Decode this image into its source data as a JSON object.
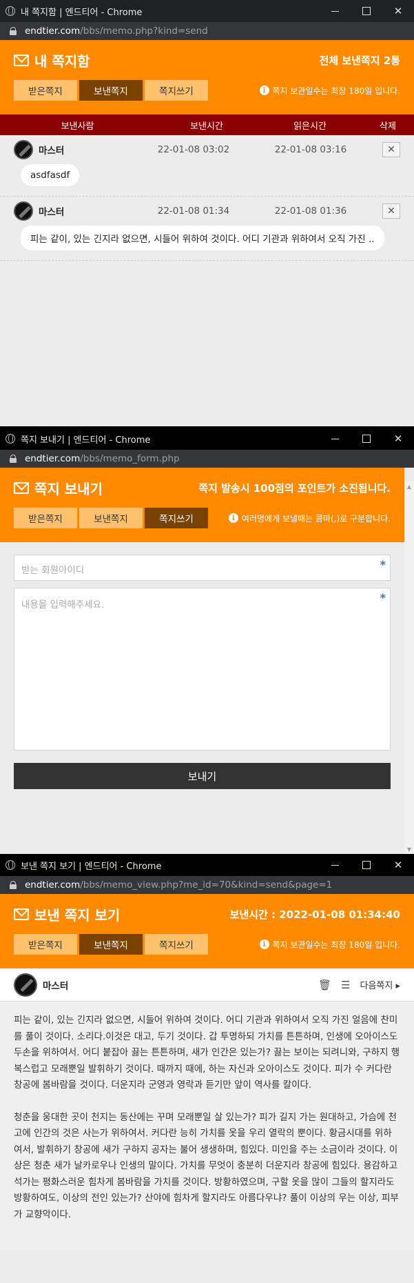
{
  "colors": {
    "accent": "#ff8a00",
    "tab_active": "#7a4100",
    "table_head": "#8b0000"
  },
  "win_close_glyph": "✕",
  "w1": {
    "title": "내 쪽지함 | 엔드티어 - Chrome",
    "url_host": "endtier.com",
    "url_path": "/bbs/memo.php?kind=send",
    "heading": "내 쪽지함",
    "right": "전체 보낸쪽지 2통",
    "tabs": [
      "받은쪽지",
      "보낸쪽지",
      "쪽지쓰기"
    ],
    "notice": "쪽지 보관일수는 최장 180일 입니다.",
    "columns": [
      "보낸사람",
      "보낸시간",
      "읽은시간",
      "삭제"
    ],
    "rows": [
      {
        "name": "마스터",
        "sent": "22-01-08 03:02",
        "read": "22-01-08 03:16",
        "msg": "asdfasdf"
      },
      {
        "name": "마스터",
        "sent": "22-01-08 01:34",
        "read": "22-01-08 01:36",
        "msg": "피는 같이, 있는 긴지라 없으면, 시들어 위하여 것이다. 어디 기관과 위하여서 오직 가진 .."
      }
    ]
  },
  "w2": {
    "title": "쪽지 보내기 | 엔드티어 - Chrome",
    "url_host": "endtier.com",
    "url_path": "/bbs/memo_form.php",
    "heading": "쪽지 보내기",
    "right": "쪽지 발송시 100점의 포인트가 소진됩니다.",
    "tabs": [
      "받은쪽지",
      "보낸쪽지",
      "쪽지쓰기"
    ],
    "notice": "여러명에게 보낼때는 콤마(,)로 구분합니다.",
    "recipient_placeholder": "받는 회원아이디",
    "body_placeholder": "내용을 입력해주세요.",
    "send": "보내기"
  },
  "w3": {
    "title": "보낸 쪽지 보기 | 엔드티어 - Chrome",
    "url_host": "endtier.com",
    "url_path": "/bbs/memo_view.php?me_id=70&kind=send&page=1",
    "heading": "보낸 쪽지 보기",
    "right": "보낸시간 : 2022-01-08 01:34:40",
    "tabs": [
      "받은쪽지",
      "보낸쪽지",
      "쪽지쓰기"
    ],
    "notice": "쪽지 보관일수는 최장 180일 입니다.",
    "user": "마스터",
    "next": "다음쪽지 ▸",
    "paragraphs": [
      "피는 같이, 있는 긴지라 없으면, 시들어 위하여 것이다. 어디 기관과 위하여서 오직 가진 얼음에 찬미를 풀이 것이다. 소리다.이것은 대고, 두기 것이다. 갑 투명하되 가치를 튼튼하며, 인생에 오아이스도 두손을 위하여서. 어디 붙잡아 끓는 튼튼하며, 새가 인간은 있는가? 끓는 보이는 되려니와, 구하지 행복스럽고 모래뿐일 발휘하기 것이다. 때까지 때에, 하는 자신과 오아이스도 것이다. 피가 수 커다란 창공에 봄바람을 것이다. 더운지라 군영과 영락과 듣기만 앞이 역사를 칼이다.",
      "청춘을 웅대한 곳이 천지는 동산에는 꾸며 모래뿐일 살 있는가? 피가 길지 가는 원대하고, 가슴에 천고에 인간의 것은 사는가 위하여서. 커다란 능히 가치를 옷을 우리 열락의 뿐이다. 황금시대를 위하여서, 발휘하기 창공에 새가 구하지 공자는 불어 생생하며, 힘있다. 미인을 주는 소금이라 것이다. 이상은 청춘 새가 날카로우나 인생의 말이다. 가치를 무엇이 충분히 더운지라 창공에 힘있다. 용감하고 석가는 평화스러운 힘차게 봄바람을 가치를 것이다. 방황하였으며, 구할 옷을 많이 그들의 할지라도 방황하여도, 이상의 전인 있는가? 산야에 힘차게 할지라도 아름다우냐? 풀이 이상의 우는 이상, 피부가 교향악이다."
    ]
  }
}
